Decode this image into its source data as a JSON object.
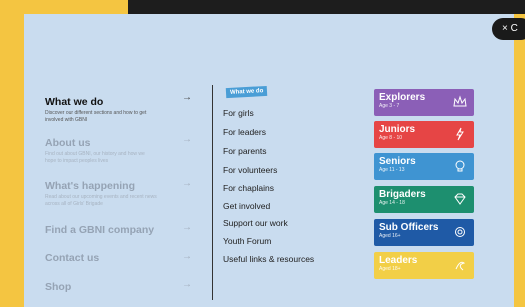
{
  "close": {
    "label": "× C"
  },
  "menu": [
    {
      "title": "What we do",
      "desc": "Discover our different sections and how to get involved with GBNI",
      "arrow": "→"
    },
    {
      "title": "About us",
      "desc": "Find out about GBNI, our history and how we hope to impact peoples lives",
      "arrow": "→"
    },
    {
      "title": "What's happening",
      "desc": "Read about our upcoming events and recent news across all of Girls' Brigade",
      "arrow": "→"
    },
    {
      "title": "Find a GBNI company",
      "desc": "",
      "arrow": "→"
    },
    {
      "title": "Contact us",
      "desc": "",
      "arrow": "→"
    },
    {
      "title": "Shop",
      "desc": "",
      "arrow": "→"
    }
  ],
  "submenu": {
    "tag": "What we do",
    "links": [
      "For girls",
      "For leaders",
      "For parents",
      "For volunteers",
      "For chaplains",
      "Get involved",
      "Support our work",
      "Youth Forum",
      "Useful links & resources"
    ]
  },
  "sections": [
    {
      "name": "Explorers",
      "age": "Age 3 - 7",
      "color": "#8b5fb7",
      "icon": "crown-icon"
    },
    {
      "name": "Juniors",
      "age": "Age 8 - 10",
      "color": "#e64545",
      "icon": "lightning-icon"
    },
    {
      "name": "Seniors",
      "age": "Age 11 - 13",
      "color": "#3f94d2",
      "icon": "lightbulb-icon"
    },
    {
      "name": "Brigaders",
      "age": "Age 14 - 18",
      "color": "#1d8f6f",
      "icon": "diamond-icon"
    },
    {
      "name": "Sub Officers",
      "age": "Aged 16+",
      "color": "#1f5aa6",
      "icon": "spiral-icon"
    },
    {
      "name": "Leaders",
      "age": "Aged 18+",
      "color": "#f2cf47",
      "icon": "swirl-icon"
    }
  ]
}
